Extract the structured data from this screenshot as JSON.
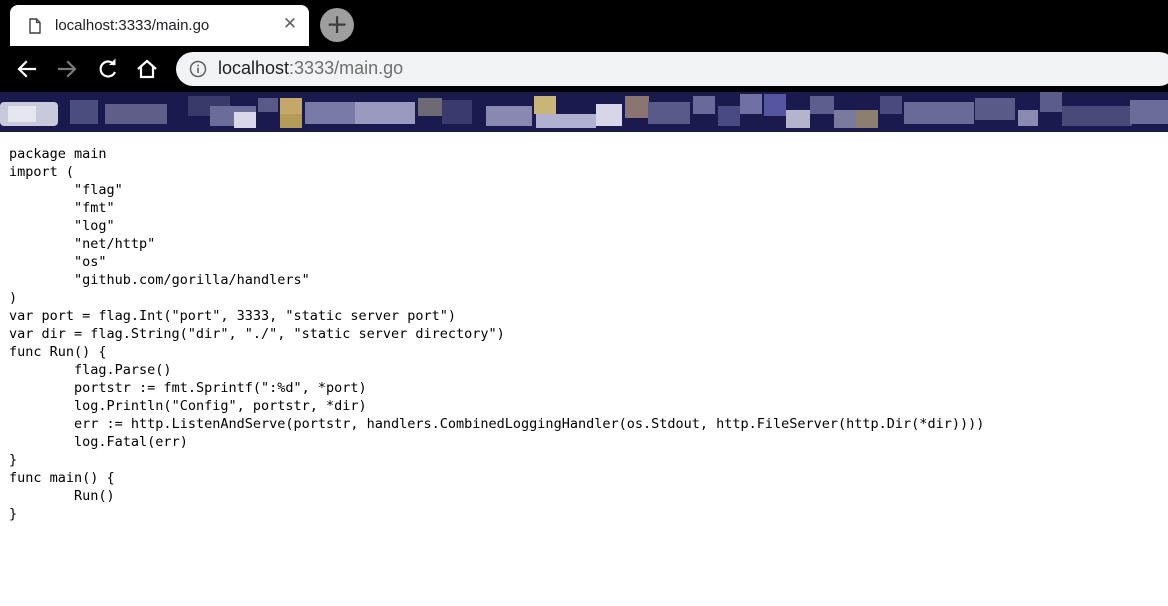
{
  "tab": {
    "title": "localhost:3333/main.go",
    "close_glyph": "✕",
    "icon": "document-icon"
  },
  "new_tab_glyph": "+",
  "toolbar": {
    "url_host": "localhost",
    "url_rest": ":3333/main.go",
    "icons": [
      "back-arrow-icon",
      "forward-arrow-icon",
      "reload-icon",
      "home-icon",
      "info-icon"
    ]
  },
  "bookmarks": {
    "redacted": true,
    "bar_color": "#1b1a4f"
  },
  "page": {
    "code": "package main\nimport (\n\t\"flag\"\n\t\"fmt\"\n\t\"log\"\n\t\"net/http\"\n\t\"os\"\n\t\"github.com/gorilla/handlers\"\n)\nvar port = flag.Int(\"port\", 3333, \"static server port\")\nvar dir = flag.String(\"dir\", \"./\", \"static server directory\")\nfunc Run() {\n\tflag.Parse()\n\tportstr := fmt.Sprintf(\":%d\", *port)\n\tlog.Println(\"Config\", portstr, *dir)\n\terr := http.ListenAndServe(portstr, handlers.CombinedLoggingHandler(os.Stdout, http.FileServer(http.Dir(*dir))))\n\tlog.Fatal(err)\n}\nfunc main() {\n\tRun()\n}"
  }
}
